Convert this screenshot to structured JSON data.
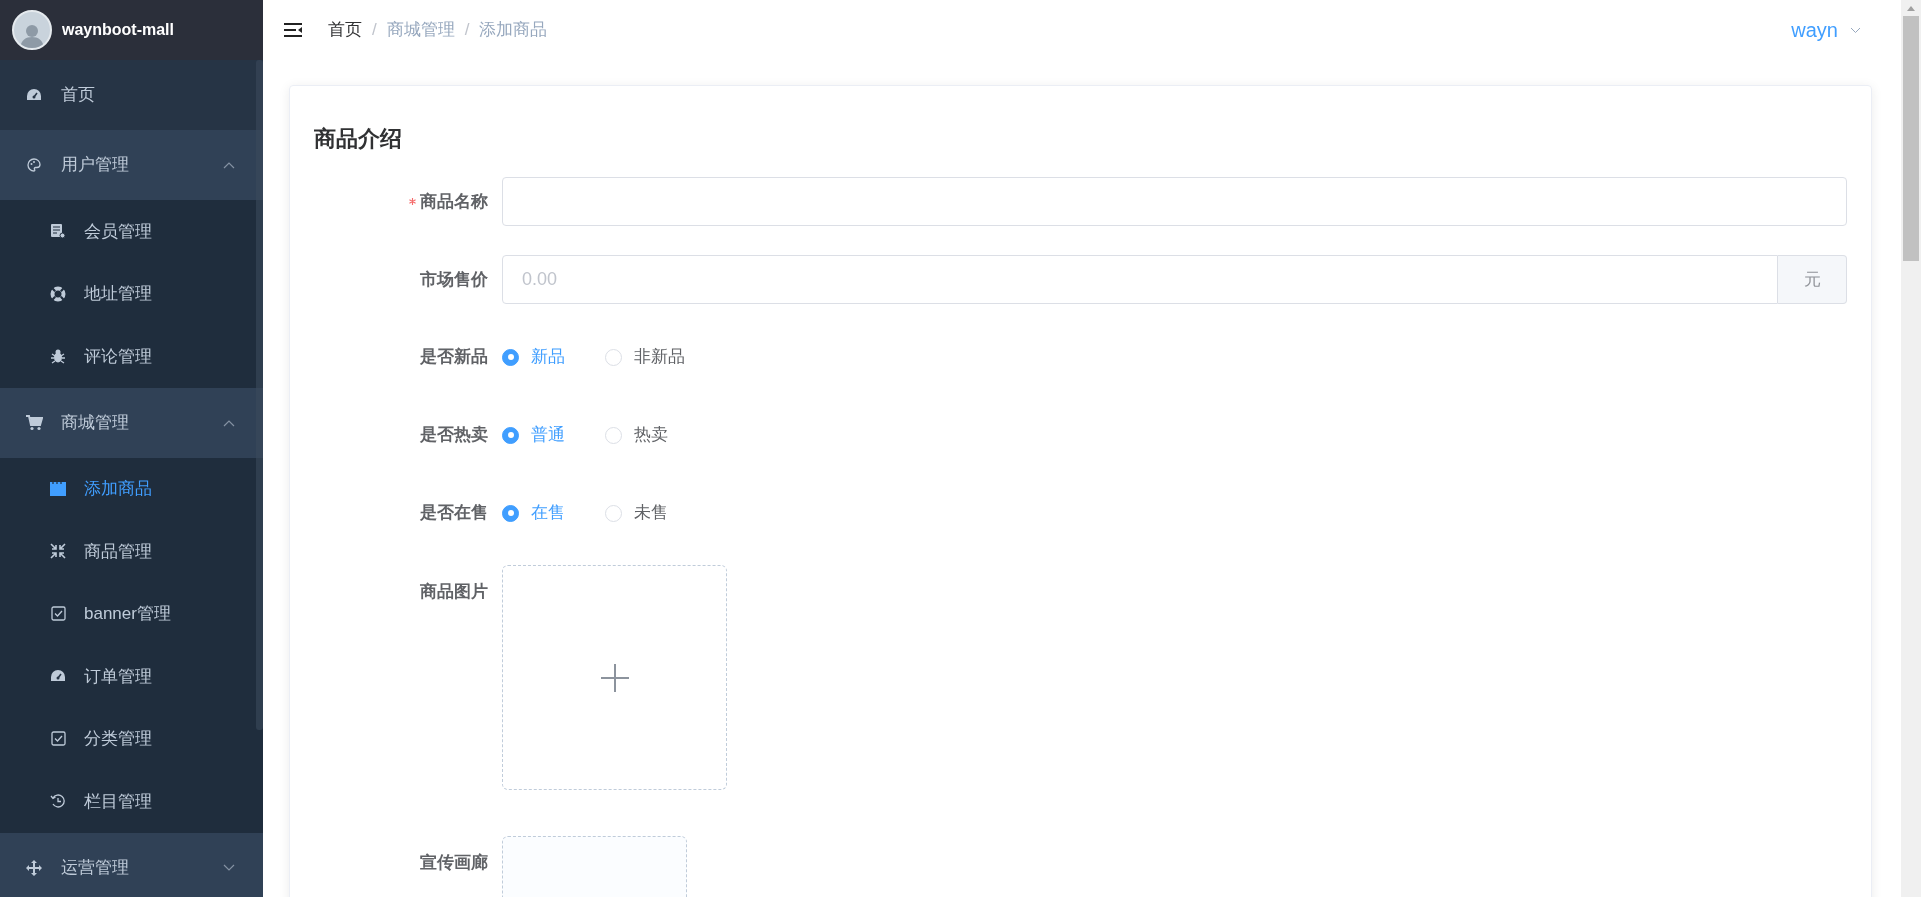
{
  "sidebar": {
    "logo": {
      "title": "waynboot-mall"
    },
    "menu": [
      {
        "label": "首页",
        "selected": false
      },
      {
        "label": "用户管理",
        "selected": false,
        "expanded": true,
        "children": [
          {
            "label": "会员管理",
            "selected": false
          },
          {
            "label": "地址管理",
            "selected": false
          },
          {
            "label": "评论管理",
            "selected": false
          }
        ]
      },
      {
        "label": "商城管理",
        "selected": false,
        "expanded": true,
        "children": [
          {
            "label": "添加商品",
            "selected": true
          },
          {
            "label": "商品管理",
            "selected": false
          },
          {
            "label": "banner管理",
            "selected": false
          },
          {
            "label": "订单管理",
            "selected": false
          },
          {
            "label": "分类管理",
            "selected": false
          },
          {
            "label": "栏目管理",
            "selected": false
          }
        ]
      },
      {
        "label": "运营管理",
        "selected": false,
        "expanded": false
      }
    ]
  },
  "header": {
    "breadcrumb": [
      {
        "label": "首页",
        "current": false
      },
      {
        "label": "商城管理",
        "current": true
      },
      {
        "label": "添加商品",
        "current": true
      }
    ],
    "separator": "/",
    "user": "wayn"
  },
  "form": {
    "section_title": "商品介绍",
    "fields": [
      {
        "kind": "text",
        "label": "商品名称",
        "required": true
      },
      {
        "kind": "suffix",
        "label": "市场售价",
        "required": false,
        "placeholder": "0.00",
        "suffix": "元"
      },
      {
        "kind": "radio",
        "label": "是否新品",
        "required": false,
        "options": [
          {
            "label": "新品",
            "selected": true
          },
          {
            "label": "非新品",
            "selected": false
          }
        ]
      },
      {
        "kind": "radio",
        "label": "是否热卖",
        "required": false,
        "options": [
          {
            "label": "普通",
            "selected": true
          },
          {
            "label": "热卖",
            "selected": false
          }
        ]
      },
      {
        "kind": "radio",
        "label": "是否在售",
        "required": false,
        "options": [
          {
            "label": "在售",
            "selected": true
          },
          {
            "label": "未售",
            "selected": false
          }
        ]
      },
      {
        "kind": "upload",
        "label": "商品图片",
        "required": false
      },
      {
        "kind": "gallery",
        "label": "宣传画廊",
        "required": false
      }
    ]
  }
}
